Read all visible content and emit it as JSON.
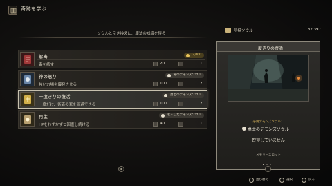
{
  "header": {
    "title": "奇跡を学ぶ",
    "icon": "book-icon"
  },
  "subtitle": "ソウルと引き換えに、魔法の知識を得る",
  "soul": {
    "label": "所持ソウル",
    "value": "82,397"
  },
  "miracles": [
    {
      "name": "解毒",
      "description": "毒を癒す",
      "requirement": "3,000",
      "requirement_icon": "soul-icon",
      "stat1": "20",
      "stat2": "1",
      "selected": false,
      "thumb_color": "#7a2a2a"
    },
    {
      "name": "神の怒り",
      "description": "強い力場を爆発させる",
      "requirement": "竜のデモンズソウル",
      "requirement_icon": "demon-soul-icon",
      "stat1": "100",
      "stat2": "2",
      "selected": false,
      "thumb_color": "#5a6f8a"
    },
    {
      "name": "一度きりの復活",
      "description": "一度だけ、術者の死を回避できる",
      "requirement": "勇士のデモンズソウル",
      "requirement_icon": "demon-soul-icon",
      "stat1": "100",
      "stat2": "2",
      "selected": true,
      "thumb_color": "#b89a3a"
    },
    {
      "name": "再生",
      "description": "HPをわずかずつ回復し続ける",
      "requirement": "老人したデモンズソウル",
      "requirement_icon": "demon-soul-icon",
      "stat1": "40",
      "stat2": "1",
      "selected": false,
      "thumb_color": "#a08a5a"
    }
  ],
  "detail": {
    "title": "一度きりの復活",
    "requirement_label": "必要デモンズソウル：",
    "required_item": "勇士のデモンズソウル",
    "status": "習得していません",
    "slot_label": "メモリースロット",
    "page_count": 3,
    "page_active": 0
  },
  "footer": [
    {
      "label": "並び替え",
      "button": "triangle-button-icon"
    },
    {
      "label": "選択",
      "button": "cross-button-icon"
    },
    {
      "label": "戻る",
      "button": "circle-button-icon"
    }
  ]
}
